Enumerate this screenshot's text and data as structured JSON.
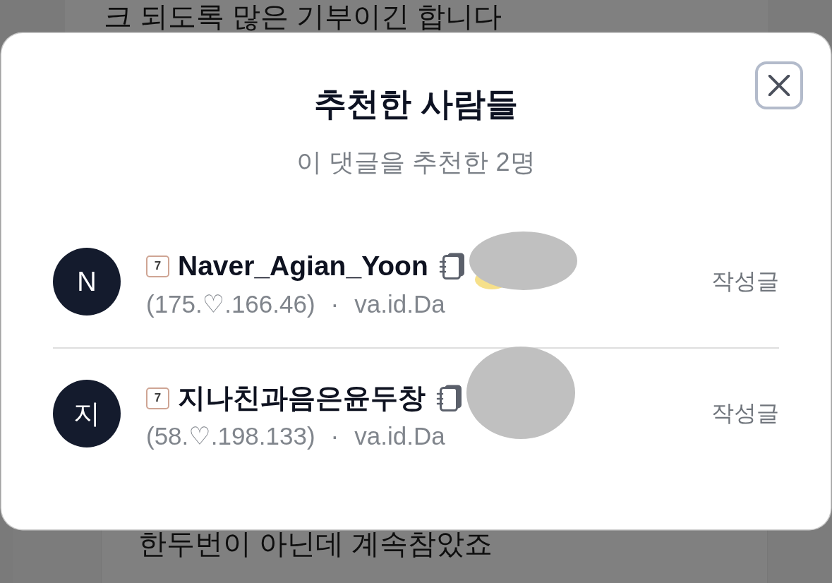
{
  "background": {
    "top_text": "크 되도록 많은 기부이긴 합니다",
    "bottom_text": "한두번이 아닌데 계속참았죠"
  },
  "dialog": {
    "title": "추천한 사람들",
    "subtitle": "이 댓글을 추천한 2명",
    "users": [
      {
        "avatar": "N",
        "rank_badge": "7",
        "name": "Naver_Agian_Yoon",
        "ip": "(175.♡.166.46)",
        "separator": "·",
        "source": "va.id.Da",
        "link": "작성글",
        "redaction": {
          "kind": "wide",
          "emblem_peek": true
        }
      },
      {
        "avatar": "지",
        "rank_badge": "7",
        "name": "지나친과음은윤두창",
        "ip": "(58.♡.198.133)",
        "separator": "·",
        "source": "va.id.Da",
        "link": "작성글",
        "redaction": {
          "kind": "round",
          "emblem_peek": false
        }
      }
    ]
  }
}
